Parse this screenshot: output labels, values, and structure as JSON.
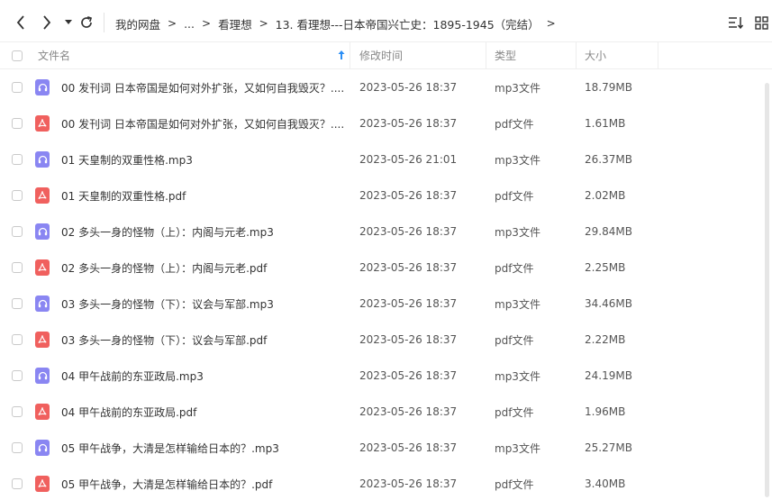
{
  "nav": {
    "back_icon": "chevron-left-icon",
    "forward_icon": "chevron-right-icon",
    "history_icon": "caret-down-icon",
    "refresh_icon": "refresh-icon"
  },
  "breadcrumb": {
    "root": "我的网盘",
    "ellipsis": "...",
    "parent": "看理想",
    "current": "13. 看理想---日本帝国兴亡史：1895-1945（完结）",
    "separator": ">"
  },
  "view": {
    "sort_icon": "sort-list-icon",
    "grid_icon": "grid-view-icon"
  },
  "table": {
    "headers": {
      "name": "文件名",
      "date": "修改时间",
      "type": "类型",
      "size": "大小"
    },
    "sort_column": "name",
    "sort_direction": "asc",
    "rows": [
      {
        "icon": "audio-file-icon",
        "kind": "mp3",
        "name": "00 发刊词 日本帝国是如何对外扩张，又如何自我毁灭？....",
        "date": "2023-05-26 18:37",
        "type": "mp3文件",
        "size": "18.79MB"
      },
      {
        "icon": "pdf-file-icon",
        "kind": "pdf",
        "name": "00 发刊词 日本帝国是如何对外扩张，又如何自我毁灭？....",
        "date": "2023-05-26 18:37",
        "type": "pdf文件",
        "size": "1.61MB"
      },
      {
        "icon": "audio-file-icon",
        "kind": "mp3",
        "name": "01 天皇制的双重性格.mp3",
        "date": "2023-05-26 21:01",
        "type": "mp3文件",
        "size": "26.37MB"
      },
      {
        "icon": "pdf-file-icon",
        "kind": "pdf",
        "name": "01 天皇制的双重性格.pdf",
        "date": "2023-05-26 18:37",
        "type": "pdf文件",
        "size": "2.02MB"
      },
      {
        "icon": "audio-file-icon",
        "kind": "mp3",
        "name": "02 多头一身的怪物（上）：内阁与元老.mp3",
        "date": "2023-05-26 18:37",
        "type": "mp3文件",
        "size": "29.84MB"
      },
      {
        "icon": "pdf-file-icon",
        "kind": "pdf",
        "name": "02 多头一身的怪物（上）：内阁与元老.pdf",
        "date": "2023-05-26 18:37",
        "type": "pdf文件",
        "size": "2.25MB"
      },
      {
        "icon": "audio-file-icon",
        "kind": "mp3",
        "name": "03 多头一身的怪物（下）：议会与军部.mp3",
        "date": "2023-05-26 18:37",
        "type": "mp3文件",
        "size": "34.46MB"
      },
      {
        "icon": "pdf-file-icon",
        "kind": "pdf",
        "name": "03 多头一身的怪物（下）：议会与军部.pdf",
        "date": "2023-05-26 18:37",
        "type": "pdf文件",
        "size": "2.22MB"
      },
      {
        "icon": "audio-file-icon",
        "kind": "mp3",
        "name": "04 甲午战前的东亚政局.mp3",
        "date": "2023-05-26 18:37",
        "type": "mp3文件",
        "size": "24.19MB"
      },
      {
        "icon": "pdf-file-icon",
        "kind": "pdf",
        "name": "04 甲午战前的东亚政局.pdf",
        "date": "2023-05-26 18:37",
        "type": "pdf文件",
        "size": "1.96MB"
      },
      {
        "icon": "audio-file-icon",
        "kind": "mp3",
        "name": "05 甲午战争，大清是怎样输给日本的？.mp3",
        "date": "2023-05-26 18:37",
        "type": "mp3文件",
        "size": "25.27MB"
      },
      {
        "icon": "pdf-file-icon",
        "kind": "pdf",
        "name": "05 甲午战争，大清是怎样输给日本的？.pdf",
        "date": "2023-05-26 18:37",
        "type": "pdf文件",
        "size": "3.40MB"
      }
    ]
  },
  "colors": {
    "mp3_icon": "#8a86f2",
    "pdf_icon": "#f0605e",
    "sort_arrow": "#2a8ef5"
  }
}
